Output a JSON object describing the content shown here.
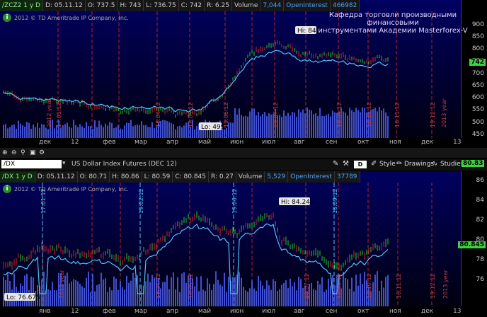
{
  "top": {
    "symbol": "/ZCZ2 1 y D",
    "date": "D: 05.11.12",
    "open": "O: 737.5",
    "high": "H: 743",
    "low": "L: 736.75",
    "close": "C: 742",
    "range": "R: 6.25",
    "volume_label": "Volume",
    "volume": "7,044",
    "oi_label": "OpenInterest",
    "oi": "466982",
    "copyright": "2012 © TD Ameritrade IP Company, Inc.",
    "title_line1": "Кафедра торговли производными финансовыми",
    "title_line2": "инструментами Академии Masterforex-V",
    "hi_label": "Hi: 849",
    "lo_label": "Lo: 499",
    "price_tag": "742",
    "yticks": [
      "900",
      "850",
      "800",
      "750",
      "700",
      "650",
      "600",
      "550",
      "500",
      "450"
    ],
    "months": [
      "дек",
      "12",
      "фев",
      "мар",
      "апр",
      "май",
      "июн",
      "июл",
      "авг",
      "сен",
      "окт",
      "ноя",
      "дек",
      "13"
    ],
    "red_dates": [
      "17.01.12",
      "18.04.12",
      "18.05.12",
      "19.06.12",
      "20.07.12",
      "18.09.12",
      "18.10.12",
      "16.11.12",
      "19.12.12"
    ],
    "year_label": "2013 year",
    "year_label_left": "2012 year"
  },
  "toolbar": {
    "style": "Style",
    "drawings": "Drawings",
    "studies": "Studies",
    "d": "D",
    "price": "80.83"
  },
  "bottom": {
    "search_value": "/DX",
    "contract": "US Dollar Index Futures (DEC 12)",
    "symbol": "/DX 1 y D",
    "date": "D: 05.11.12",
    "open": "O: 80.71",
    "high": "H: 80.86",
    "low": "L: 80.59",
    "close": "C: 80.845",
    "range": "R: 0.27",
    "volume_label": "Volume",
    "volume": "5,529",
    "oi_label": "OpenInterest",
    "oi": "37789",
    "copyright": "2012 © TD Ameritrade IP Company, Inc.",
    "hi_label": "Hi: 84.245",
    "lo_label": "Lo: 76.675",
    "price_tag": "80.845",
    "yticks": [
      "86",
      "84",
      "82",
      "80",
      "78",
      "76"
    ],
    "months": [
      "янв",
      "12",
      "фев",
      "мар",
      "апр",
      "май",
      "июн",
      "июл",
      "авг",
      "сен",
      "окт",
      "ноя",
      "дек",
      "13"
    ],
    "cyan_labels": [
      "17.01.12",
      "19.02.12",
      "19.06.12",
      "18.09.12"
    ],
    "red_dates": [
      "18.04.12",
      "18.05.12",
      "20.07.12",
      "18.09.12",
      "18.10.12",
      "16.11.12",
      "19.12.12"
    ],
    "year_label": "2012 year",
    "year_label_right": "2013 year"
  }
}
